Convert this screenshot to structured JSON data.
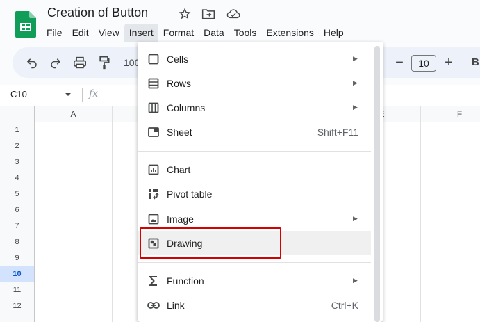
{
  "header": {
    "doc_title": "Creation of Button",
    "menus": [
      "File",
      "Edit",
      "View",
      "Insert",
      "Format",
      "Data",
      "Tools",
      "Extensions",
      "Help"
    ]
  },
  "toolbar": {
    "zoom": "100",
    "font_size": "10",
    "minus": "−",
    "plus": "+",
    "bold": "B"
  },
  "formula_bar": {
    "cell_ref": "C10",
    "fx": "fx"
  },
  "grid": {
    "columns": [
      "A",
      "E",
      "F"
    ],
    "rows": [
      "1",
      "2",
      "3",
      "4",
      "5",
      "6",
      "7",
      "8",
      "9",
      "10",
      "11",
      "12"
    ],
    "selected_row": "10"
  },
  "insert_menu": {
    "items": [
      {
        "label": "Cells",
        "icon": "cells-icon",
        "submenu": true,
        "shortcut": ""
      },
      {
        "label": "Rows",
        "icon": "rows-icon",
        "submenu": true,
        "shortcut": ""
      },
      {
        "label": "Columns",
        "icon": "columns-icon",
        "submenu": true,
        "shortcut": ""
      },
      {
        "label": "Sheet",
        "icon": "sheet-icon",
        "submenu": false,
        "shortcut": "Shift+F11"
      },
      {
        "label": "Chart",
        "icon": "chart-icon",
        "submenu": false,
        "shortcut": ""
      },
      {
        "label": "Pivot table",
        "icon": "pivot-table-icon",
        "submenu": false,
        "shortcut": ""
      },
      {
        "label": "Image",
        "icon": "image-icon",
        "submenu": true,
        "shortcut": ""
      },
      {
        "label": "Drawing",
        "icon": "drawing-icon",
        "submenu": false,
        "shortcut": ""
      },
      {
        "label": "Function",
        "icon": "sigma-icon",
        "submenu": true,
        "shortcut": ""
      },
      {
        "label": "Link",
        "icon": "link-icon",
        "submenu": false,
        "shortcut": "Ctrl+K"
      }
    ],
    "submenu_arrow": "▶"
  },
  "colors": {
    "accent": "#0b57d0",
    "highlight_border": "#d50000",
    "sheets_green": "#0f9d58"
  }
}
